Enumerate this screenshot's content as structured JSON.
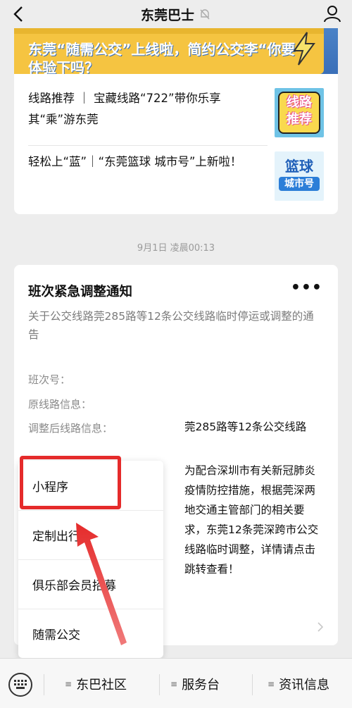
{
  "header": {
    "title": "东莞巴士"
  },
  "banner": {
    "line1": "东莞“随需公交”上线啦，简约公交李“你要",
    "line2": "体验下吗？"
  },
  "articles": [
    {
      "text": "线路推荐 ｜ 宝藏线路“722”带你乐享其“乘”游东莞",
      "thumb_label1": "线路",
      "thumb_label2": "推荐"
    },
    {
      "text": "轻松上“蓝”｜“东莞篮球 城市号”上新啦！",
      "thumb_label1": "篮球",
      "thumb_label2": "城市号"
    }
  ],
  "timestamp": "9月1日 凌晨00:13",
  "notice": {
    "title": "班次紧急调整通知",
    "more": "•••",
    "desc": "关于公交线路莞285路等12条公交线路临时停运或调整的通告",
    "fields": [
      {
        "label": "班次号：",
        "value": ""
      },
      {
        "label": "原线路信息：",
        "value": ""
      },
      {
        "label": "调整后线路信息：",
        "value": "莞285路等12条公交线路"
      }
    ],
    "remark": "为配合深圳市有关新冠肺炎疫情防控措施，根据莞深两地交通主管部门的相关要求，东莞12条莞深跨市公交线路临时调整，详情请点击跳转查看！"
  },
  "popup": {
    "items": [
      "小程序",
      "定制出行",
      "俱乐部会员招募",
      "随需公交"
    ]
  },
  "bottom": {
    "tabs": [
      "东巴社区",
      "服务台",
      "资讯信息"
    ]
  },
  "colors": {
    "highlight": "#e52b2b",
    "background": "#ededed"
  }
}
